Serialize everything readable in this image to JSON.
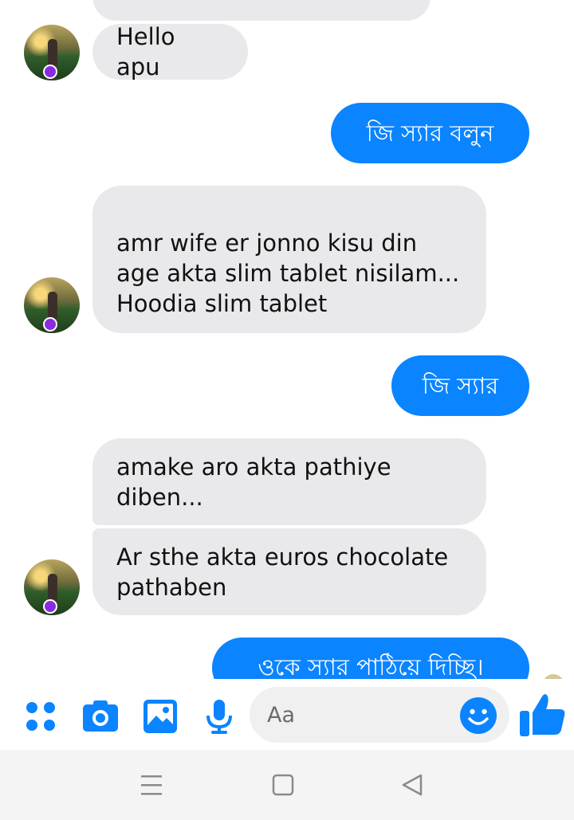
{
  "messages": [
    {
      "dir": "in",
      "text": "Hello apu"
    },
    {
      "dir": "out",
      "text": "জি স্যার বলুন"
    },
    {
      "dir": "in",
      "text": "amr wife er jonno kisu din age akta slim tablet nisilam... Hoodia slim tablet"
    },
    {
      "dir": "out",
      "text": "জি স্যার"
    },
    {
      "dir": "in",
      "text": "amake aro akta pathiye diben..."
    },
    {
      "dir": "in",
      "text": "Ar sthe akta euros chocolate pathaben"
    },
    {
      "dir": "out",
      "text": "ওকে স্যার পাঠিয়ে দিচ্ছি।"
    }
  ],
  "composer": {
    "placeholder": "Aa"
  },
  "colors": {
    "accent": "#0a84ff",
    "incoming_bubble": "#e9e9eb"
  },
  "icons": [
    "apps-icon",
    "camera-icon",
    "gallery-icon",
    "microphone-icon",
    "emoji-icon",
    "like-icon",
    "nav-recents-icon",
    "nav-home-icon",
    "nav-back-icon"
  ]
}
